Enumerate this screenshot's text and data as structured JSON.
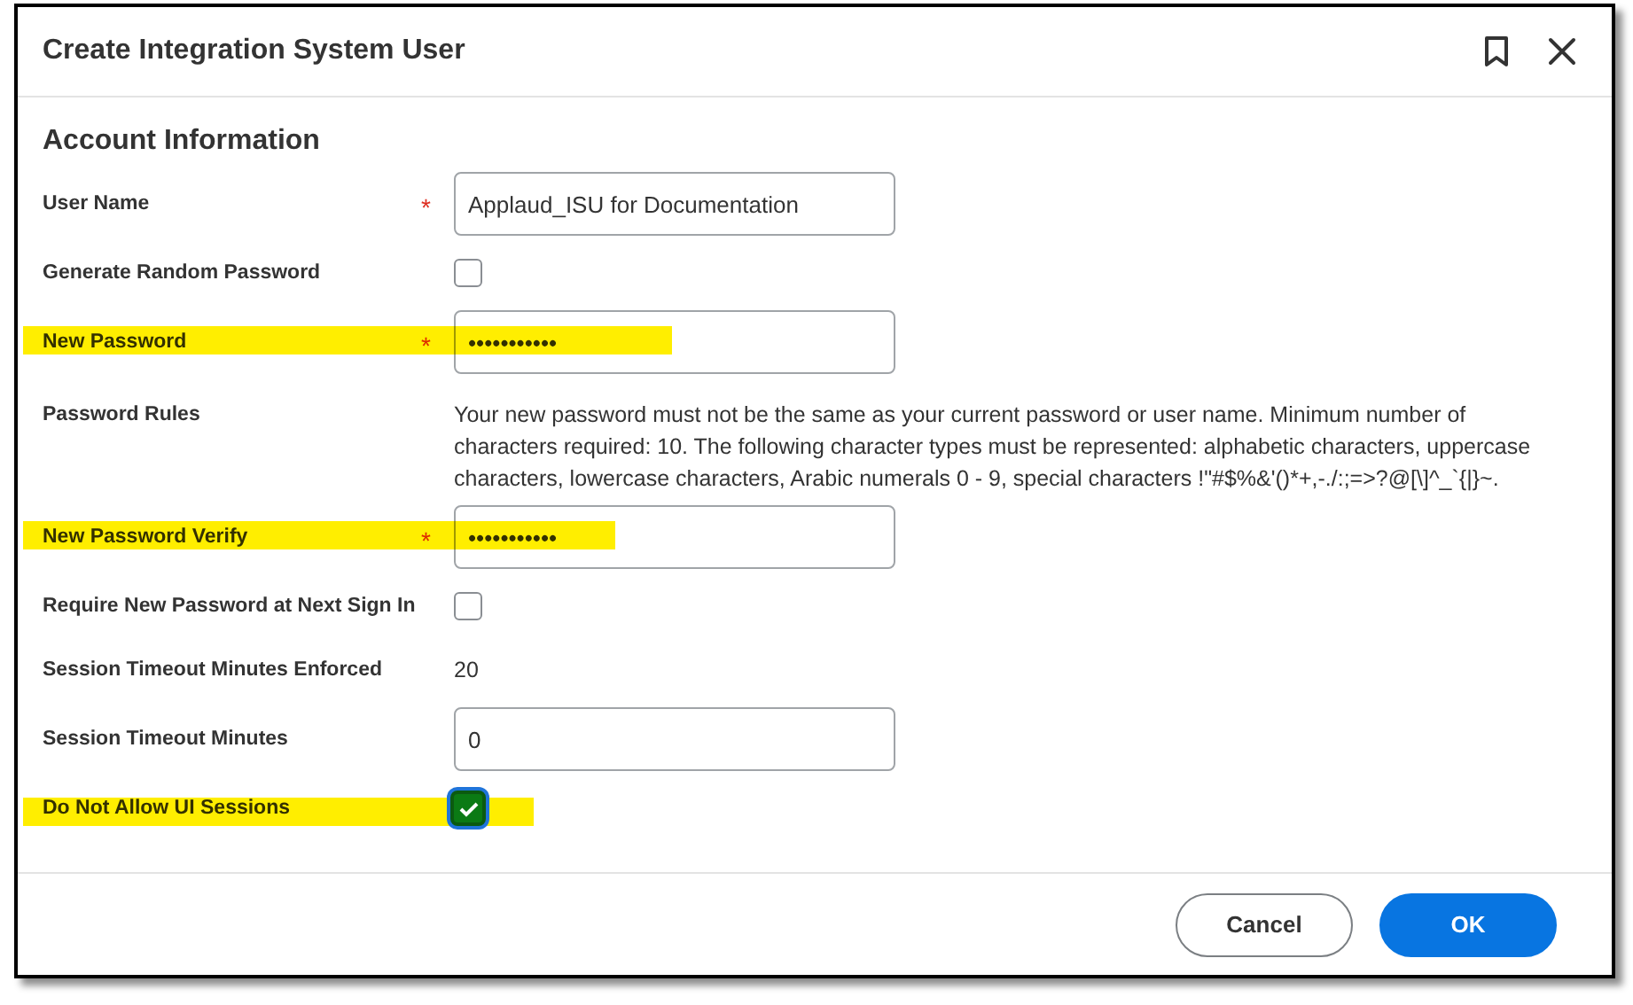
{
  "window": {
    "title": "Create Integration System User"
  },
  "section": {
    "title": "Account Information"
  },
  "fields": [
    {
      "kind": "text",
      "label": "User Name",
      "required_mark": "*",
      "highlighted": false,
      "value": "Applaud_ISU for Documentation"
    },
    {
      "kind": "checkbox",
      "label": "Generate Random Password",
      "highlighted": false,
      "checked": false
    },
    {
      "kind": "text",
      "label": "New Password",
      "required_mark": "*",
      "highlighted": true,
      "value": "•••••••••••"
    },
    {
      "kind": "note",
      "label": "Password Rules",
      "highlighted": false,
      "value": "Your new password must not be the same as your current password or user name. Minimum number of characters required: 10. The following character types must be represented: alphabetic characters, uppercase characters, lowercase characters, Arabic numerals 0 - 9, special characters !\"#$%&'()*+,-./:;=>?@[\\]^_`{|}~."
    },
    {
      "kind": "text",
      "label": "New Password Verify",
      "required_mark": "*",
      "highlighted": true,
      "value": "•••••••••••"
    },
    {
      "kind": "checkbox",
      "label": "Require New Password at Next Sign In",
      "highlighted": false,
      "checked": false
    },
    {
      "kind": "readonly",
      "label": "Session Timeout Minutes Enforced",
      "highlighted": false,
      "value": "20"
    },
    {
      "kind": "text",
      "label": "Session Timeout Minutes",
      "highlighted": false,
      "value": "0"
    },
    {
      "kind": "checkbox",
      "label": "Do Not Allow UI Sessions",
      "highlighted": true,
      "checked": true
    }
  ],
  "buttons": [
    {
      "label": "Cancel",
      "kind": "secondary"
    },
    {
      "label": "OK",
      "kind": "primary"
    }
  ]
}
